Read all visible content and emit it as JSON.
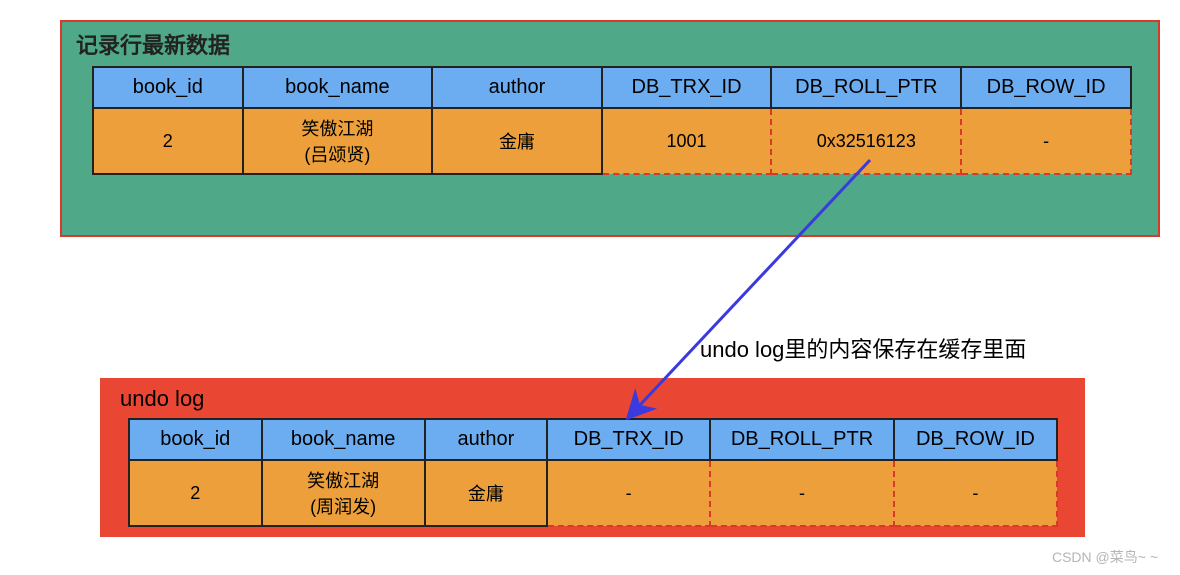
{
  "top": {
    "title": "记录行最新数据",
    "headers": [
      "book_id",
      "book_name",
      "author",
      "DB_TRX_ID",
      "DB_ROLL_PTR",
      "DB_ROW_ID"
    ],
    "row": {
      "book_id": "2",
      "book_name_line1": "笑傲江湖",
      "book_name_line2": "(吕颂贤)",
      "author": "金庸",
      "db_trx_id": "1001",
      "db_roll_ptr": "0x32516123",
      "db_row_id": "-"
    }
  },
  "annotation": "undo log里的内容保存在缓存里面",
  "bottom": {
    "title": "undo log",
    "headers": [
      "book_id",
      "book_name",
      "author",
      "DB_TRX_ID",
      "DB_ROLL_PTR",
      "DB_ROW_ID"
    ],
    "row": {
      "book_id": "2",
      "book_name_line1": "笑傲江湖",
      "book_name_line2": "(周润发)",
      "author": "金庸",
      "db_trx_id": "-",
      "db_roll_ptr": "-",
      "db_row_id": "-"
    }
  },
  "watermark": "CSDN @菜鸟~ ~",
  "chart_data": {
    "type": "table",
    "tables": [
      {
        "title": "记录行最新数据",
        "columns": [
          "book_id",
          "book_name",
          "author",
          "DB_TRX_ID",
          "DB_ROLL_PTR",
          "DB_ROW_ID"
        ],
        "rows": [
          [
            "2",
            "笑傲江湖(吕颂贤)",
            "金庸",
            "1001",
            "0x32516123",
            "-"
          ]
        ]
      },
      {
        "title": "undo log",
        "columns": [
          "book_id",
          "book_name",
          "author",
          "DB_TRX_ID",
          "DB_ROLL_PTR",
          "DB_ROW_ID"
        ],
        "rows": [
          [
            "2",
            "笑傲江湖(周润发)",
            "金庸",
            "-",
            "-",
            "-"
          ]
        ]
      }
    ],
    "arrow": {
      "from": "记录行最新数据.DB_ROLL_PTR",
      "to": "undo log",
      "label": "undo log里的内容保存在缓存里面"
    }
  }
}
